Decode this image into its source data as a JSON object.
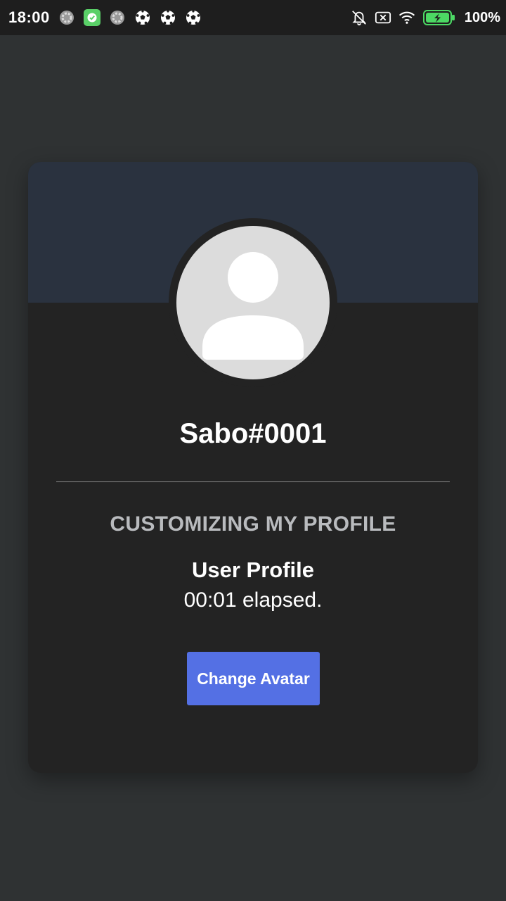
{
  "status_bar": {
    "time": "18:00",
    "battery_percent": "100%",
    "left_icons": [
      "spinner-icon",
      "app-check-icon",
      "spinner-icon",
      "soccer-ball-icon",
      "soccer-ball-icon",
      "soccer-ball-icon"
    ],
    "right_icons": [
      "bell-muted-icon",
      "no-sim-icon",
      "wifi-icon",
      "battery-charging-icon"
    ],
    "colors": {
      "background": "#1e1e1e",
      "battery_fill": "#4cd964",
      "app_icon": "#5ad068"
    }
  },
  "profile_card": {
    "username": "Sabo#0001",
    "activity_heading": "CUSTOMIZING MY PROFILE",
    "activity_name": "User Profile",
    "activity_elapsed": "00:01 elapsed.",
    "change_avatar_label": "Change Avatar",
    "avatar_icon": "default-user-avatar-icon",
    "colors": {
      "card_background": "#232323",
      "banner": "#2a323f",
      "button": "#5470e4",
      "heading_text": "#b9bbbe",
      "page_background": "#2f3233"
    }
  }
}
